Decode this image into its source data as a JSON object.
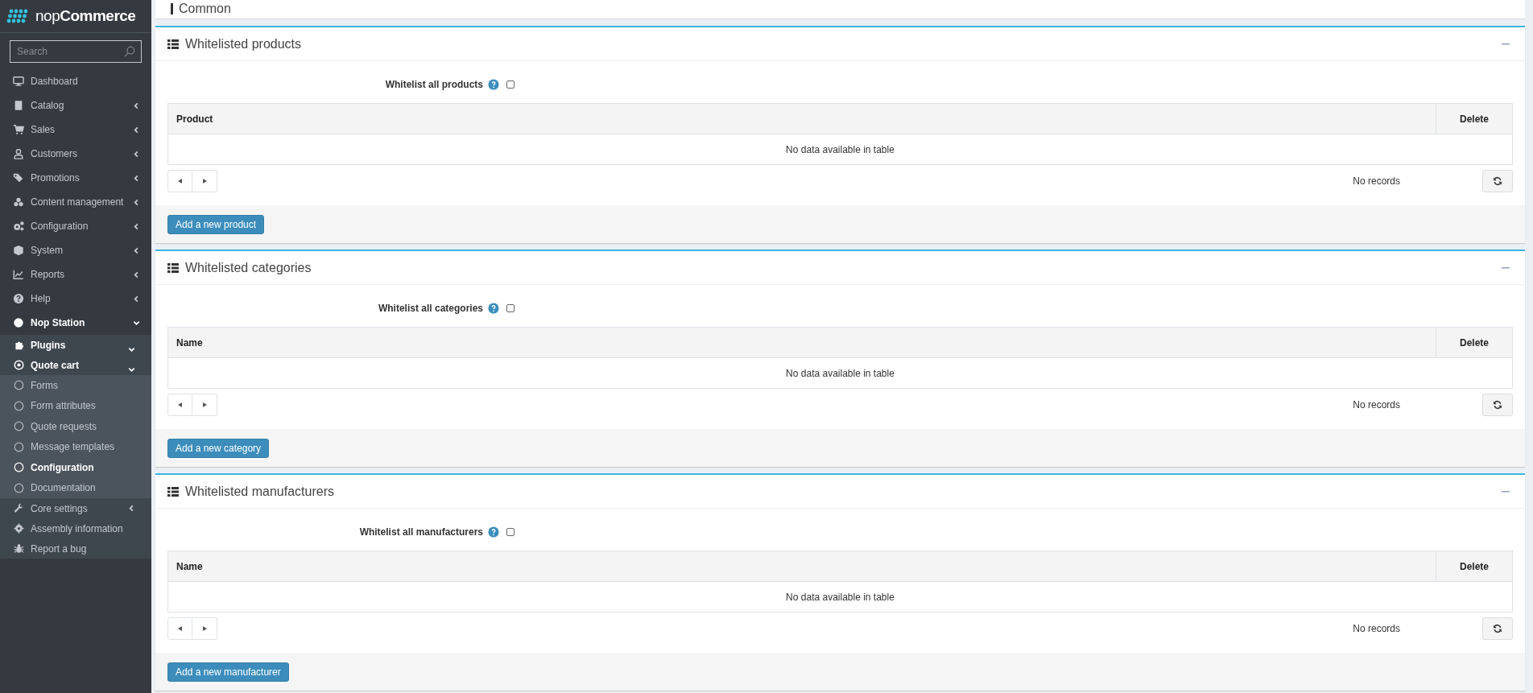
{
  "sidebar": {
    "logo": "nop**Commerce**",
    "search": {
      "placeholder": "Search"
    },
    "items": [
      {
        "label": "Dashboard"
      },
      {
        "label": "Catalog",
        "expanded": false
      },
      {
        "label": "Sales",
        "expanded": false
      },
      {
        "label": "Customers",
        "expanded": false
      },
      {
        "label": "Promotions",
        "expanded": false
      },
      {
        "label": "Content management",
        "expanded": false
      },
      {
        "label": "Configuration",
        "expanded": false
      },
      {
        "label": "System",
        "expanded": false
      },
      {
        "label": "Reports",
        "expanded": false
      },
      {
        "label": "Help",
        "expanded": false
      },
      {
        "label": "Nop Station",
        "expanded": true,
        "children": [
          {
            "label": "Plugins",
            "expanded": true,
            "children": [
              {
                "label": "Quote cart",
                "expanded": true,
                "children": [
                  {
                    "label": "Forms",
                    "selected": false
                  },
                  {
                    "label": "Form attributes",
                    "selected": false
                  },
                  {
                    "label": "Quote requests",
                    "selected": false
                  },
                  {
                    "label": "Message templates",
                    "selected": false
                  },
                  {
                    "label": "Configuration",
                    "selected": true
                  },
                  {
                    "label": "Documentation",
                    "selected": false
                  }
                ]
              }
            ]
          },
          {
            "label": "Core settings",
            "expanded": false
          },
          {
            "label": "Assembly information"
          },
          {
            "label": "Report a bug"
          }
        ]
      }
    ]
  },
  "common_card": {
    "title": "Common"
  },
  "cards": [
    {
      "title": "Whitelisted products",
      "whitelist_all": {
        "label": "Whitelist all products",
        "checked": false
      },
      "table": {
        "columns": [
          "Product",
          "Delete"
        ],
        "empty_message": "No data available in table"
      },
      "pager_status": "No records",
      "add_button": "Add a new product"
    },
    {
      "title": "Whitelisted categories",
      "whitelist_all": {
        "label": "Whitelist all categories",
        "checked": false
      },
      "table": {
        "columns": [
          "Name",
          "Delete"
        ],
        "empty_message": "No data available in table"
      },
      "pager_status": "No records",
      "add_button": "Add a new category"
    },
    {
      "title": "Whitelisted manufacturers",
      "whitelist_all": {
        "label": "Whitelist all manufacturers",
        "checked": false
      },
      "table": {
        "columns": [
          "Name",
          "Delete"
        ],
        "empty_message": "No data available in table"
      },
      "pager_status": "No records",
      "add_button": "Add a new manufacturer"
    }
  ]
}
